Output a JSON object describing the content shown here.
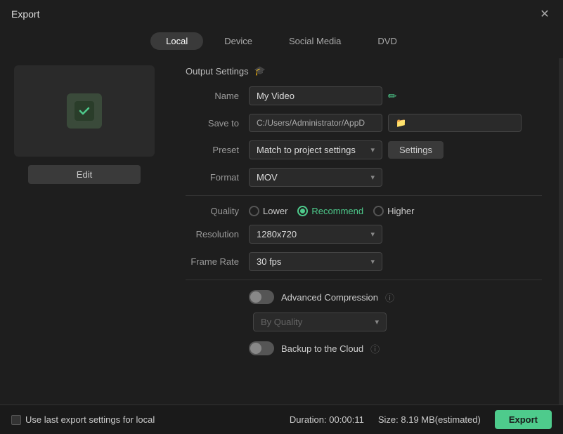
{
  "titleBar": {
    "title": "Export",
    "closeLabel": "✕"
  },
  "tabs": [
    {
      "id": "local",
      "label": "Local",
      "active": true
    },
    {
      "id": "device",
      "label": "Device",
      "active": false
    },
    {
      "id": "social",
      "label": "Social Media",
      "active": false
    },
    {
      "id": "dvd",
      "label": "DVD",
      "active": false
    }
  ],
  "outputSettings": {
    "title": "Output Settings",
    "name": {
      "label": "Name",
      "value": "My Video",
      "aiIcon": "✏"
    },
    "saveTo": {
      "label": "Save to",
      "path": "C:/Users/Administrator/AppD",
      "folderIcon": "📁"
    },
    "preset": {
      "label": "Preset",
      "value": "Match to project settings",
      "settingsBtn": "Settings"
    },
    "format": {
      "label": "Format",
      "value": "MOV"
    },
    "quality": {
      "label": "Quality",
      "options": [
        {
          "id": "lower",
          "label": "Lower",
          "selected": false
        },
        {
          "id": "recommend",
          "label": "Recommend",
          "selected": true
        },
        {
          "id": "higher",
          "label": "Higher",
          "selected": false
        }
      ]
    },
    "resolution": {
      "label": "Resolution",
      "value": "1280x720"
    },
    "frameRate": {
      "label": "Frame Rate",
      "value": "30 fps"
    },
    "advancedCompression": {
      "label": "Advanced Compression",
      "enabled": false
    },
    "byQuality": {
      "label": "By Quality"
    },
    "backupToCloud": {
      "label": "Backup to the Cloud",
      "enabled": false
    }
  },
  "bottomBar": {
    "checkboxLabel": "Use last export settings for local",
    "duration": "Duration: 00:00:11",
    "size": "Size: 8.19 MB(estimated)",
    "exportLabel": "Export"
  }
}
